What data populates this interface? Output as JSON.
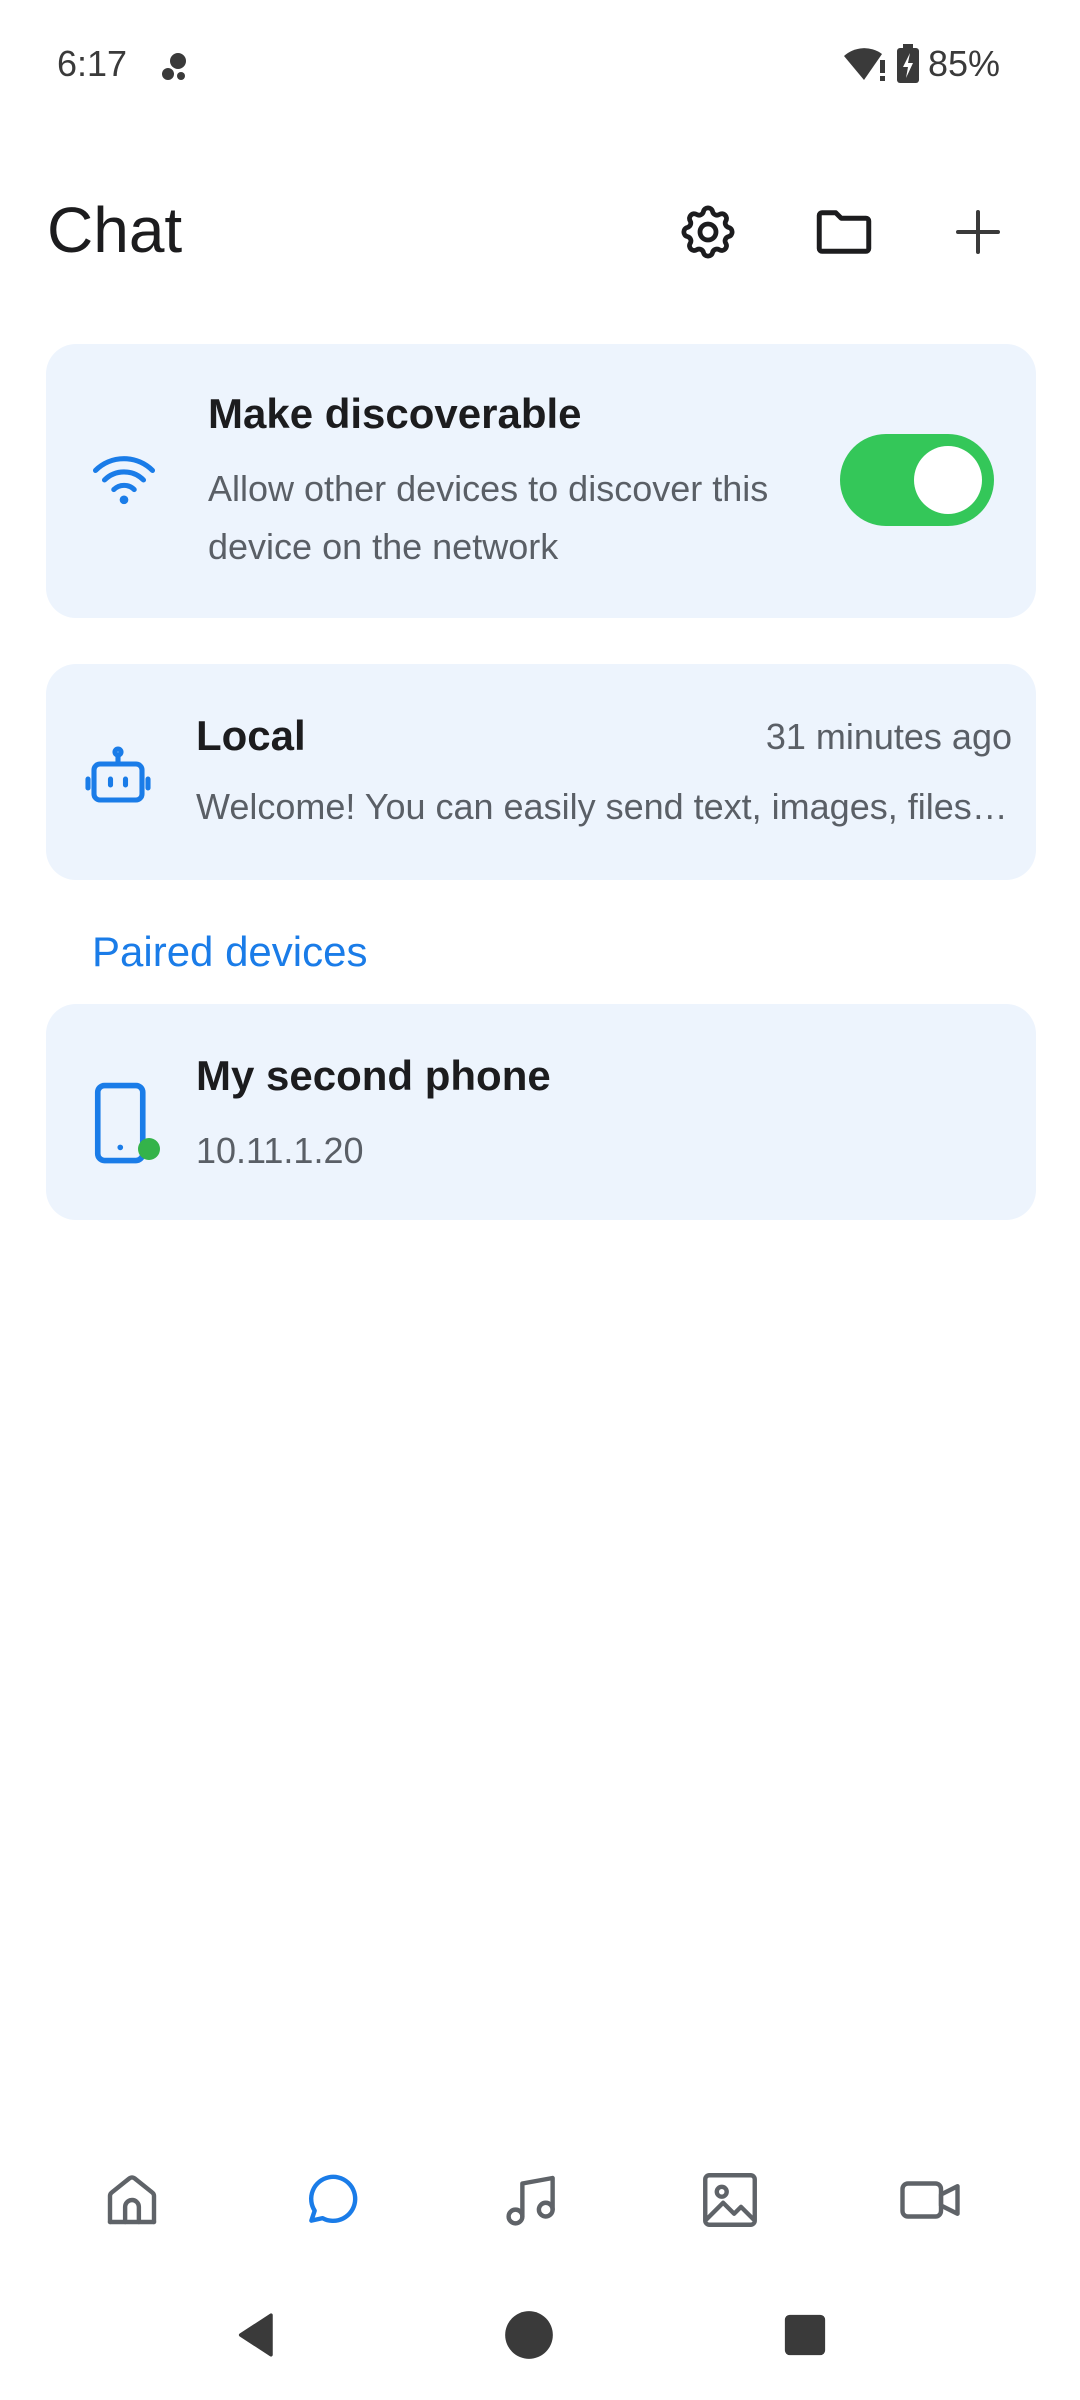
{
  "status_bar": {
    "time": "6:17",
    "battery_percent": "85%"
  },
  "header": {
    "title": "Chat",
    "actions": [
      {
        "name": "settings",
        "icon": "gear-icon"
      },
      {
        "name": "files",
        "icon": "folder-icon"
      },
      {
        "name": "add",
        "icon": "plus-icon"
      }
    ]
  },
  "discoverable": {
    "title": "Make discoverable",
    "description": "Allow other devices to discover this device on the network",
    "enabled": true,
    "icon": "wifi-icon"
  },
  "local_chat": {
    "title": "Local",
    "time": "31 minutes ago",
    "preview": "Welcome! You can easily send text, images, files and more between devices.",
    "icon": "robot-icon"
  },
  "paired_section": {
    "label": "Paired devices"
  },
  "paired_devices": [
    {
      "name": "My second phone",
      "ip": "10.11.1.20",
      "online": true,
      "icon": "phone-icon"
    }
  ],
  "bottom_nav": {
    "items": [
      {
        "name": "home",
        "icon": "home-icon",
        "active": false
      },
      {
        "name": "chat",
        "icon": "chat-bubble-icon",
        "active": true
      },
      {
        "name": "music",
        "icon": "music-note-icon",
        "active": false
      },
      {
        "name": "images",
        "icon": "image-icon",
        "active": false
      },
      {
        "name": "videos",
        "icon": "video-camera-icon",
        "active": false
      }
    ]
  },
  "colors": {
    "accent": "#1a7ce8",
    "toggle_on": "#34c759",
    "card_background": "#edf4fd",
    "online": "#34b34a",
    "icon_default": "#5f6368"
  }
}
